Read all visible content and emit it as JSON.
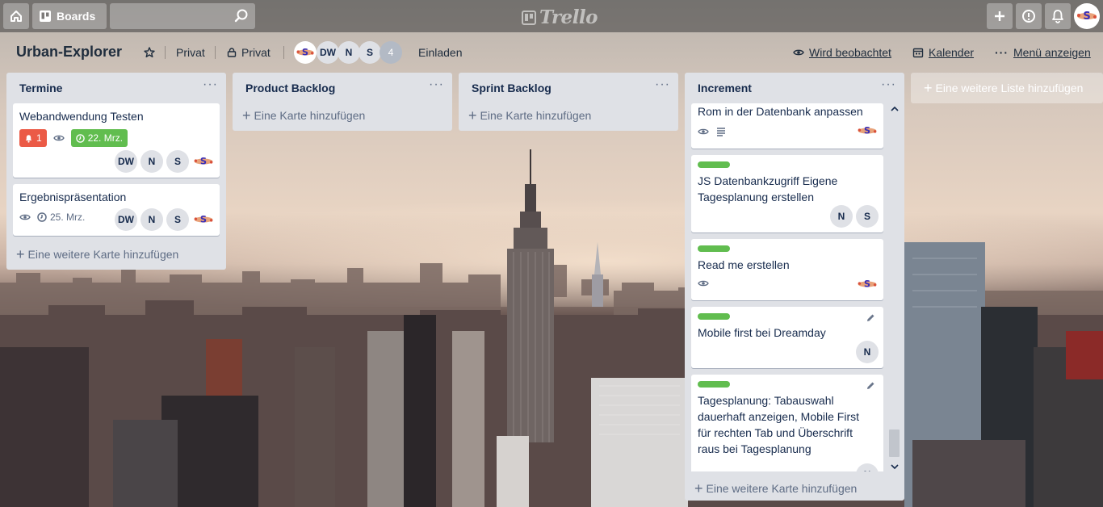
{
  "header": {
    "boards_label": "Boards",
    "search_placeholder": "",
    "logo_text": "Trello"
  },
  "board": {
    "title": "Urban-Explorer",
    "visibility_1": "Privat",
    "visibility_2": "Privat",
    "member_initials": [
      "DW",
      "N",
      "S"
    ],
    "member_count": "4",
    "invite_label": "Einladen",
    "watching_label": "Wird beobachtet",
    "calendar_label": "Kalender",
    "menu_label": "Menü anzeigen"
  },
  "lists": [
    {
      "title": "Termine",
      "add_label": "Eine weitere Karte hinzufügen",
      "cards": [
        {
          "title": "Webandwendung Testen",
          "notif_count": "1",
          "due": "22. Mrz.",
          "members": [
            "DW",
            "N",
            "S"
          ]
        },
        {
          "title": "Ergebnispräsentation",
          "due": "25. Mrz.",
          "members": [
            "DW",
            "N",
            "S"
          ]
        }
      ]
    },
    {
      "title": "Product Backlog",
      "add_label": "Eine Karte hinzufügen"
    },
    {
      "title": "Sprint Backlog",
      "add_label": "Eine Karte hinzufügen"
    },
    {
      "title": "Increment",
      "add_label": "Eine weitere Karte hinzufügen",
      "cards": [
        {
          "title": "Rom in der Datenbank anpassen"
        },
        {
          "title": "JS Datenbankzugriff Eigene Tagesplanung erstellen",
          "members": [
            "N",
            "S"
          ]
        },
        {
          "title": "Read me erstellen"
        },
        {
          "title": "Mobile first bei Dreamday",
          "members": [
            "N"
          ]
        },
        {
          "title": "Tagesplanung: Tabauswahl dauerhaft anzeigen, Mobile First für rechten Tab und Überschrift raus bei Tagesplanung",
          "members": [
            "N"
          ]
        }
      ]
    }
  ],
  "add_list_label": "Eine weitere Liste hinzufügen",
  "colors": {
    "label_green": "#61bd4f",
    "badge_red": "#eb5a46",
    "list_bg": "#dfe1e6"
  }
}
